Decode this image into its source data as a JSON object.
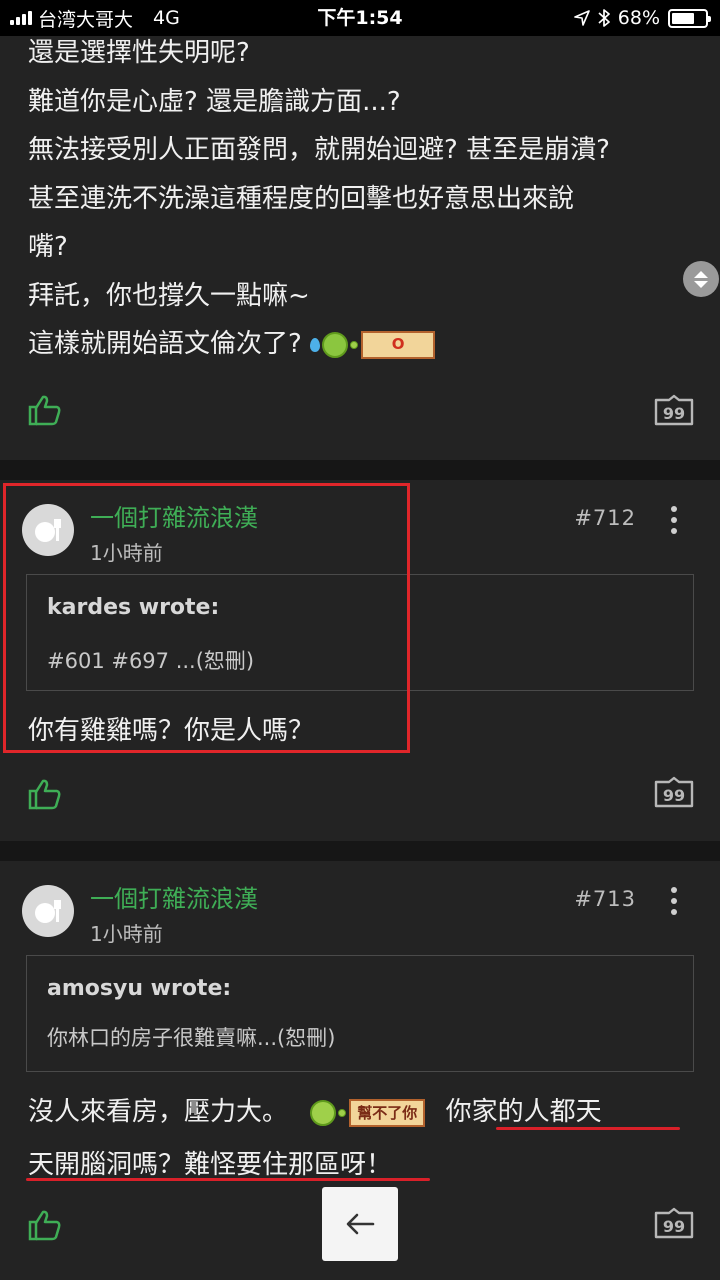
{
  "status_bar": {
    "carrier": "台湾大哥大",
    "network": "4G",
    "time": "下午1:54",
    "battery": "68%",
    "battery_level": 0.68
  },
  "post_711": {
    "lines": [
      "還是選擇性失明呢?",
      "難道你是心虛? 還是膽識方面...?",
      "無法接受別人正面發問，就開始迴避? 甚至是崩潰?",
      "甚至連洗不洗澡這種程度的回擊也好意思出來說",
      "嘴?",
      "拜託，你也撐久一點嘛~",
      "這樣就開始語文倫次了?"
    ],
    "sticker_sign": "O"
  },
  "post_712": {
    "author": "一個打雜流浪漢",
    "time": "1小時前",
    "floor": "#712",
    "quote_author": "kardes wrote:",
    "quote_text": "#601 #697 ...(恕刪)",
    "reply": "你有雞雞嗎？你是人嗎？"
  },
  "post_713": {
    "author": "一個打雜流浪漢",
    "time": "1小時前",
    "floor": "#713",
    "quote_author": "amosyu wrote:",
    "quote_text": "你林口的房子很難賣嘛...(恕刪)",
    "reply_part1": "沒人來看房，壓力大。",
    "sticker_sign": "幫不了你",
    "reply_part2": "你家的人都天",
    "reply_line2": "天開腦洞嗎？難怪要住那區呀！"
  },
  "icons": {
    "like": "thumbs-up-icon",
    "quote": "quote-icon",
    "more": "more-vertical-icon",
    "back": "arrow-left-icon"
  },
  "colors": {
    "author": "#3fae56",
    "like": "#3fae56",
    "highlight": "#e0262a"
  }
}
